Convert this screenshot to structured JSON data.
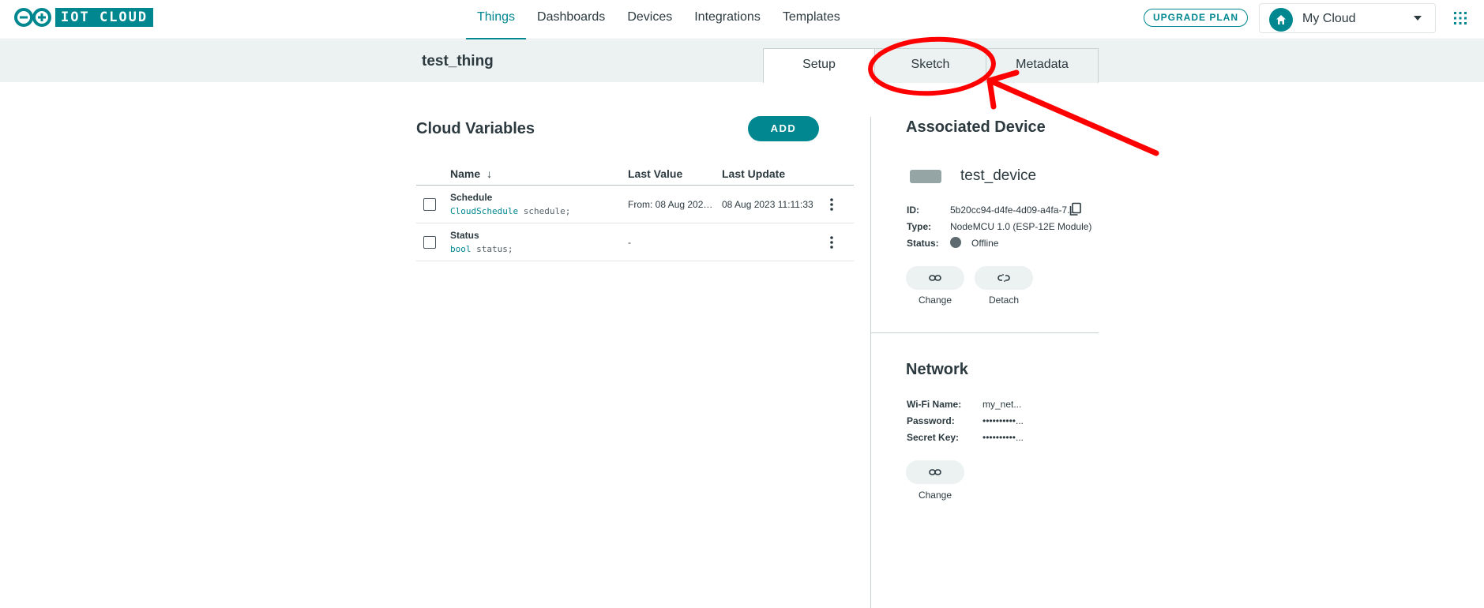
{
  "header": {
    "logo_text": "IOT CLOUD",
    "nav": [
      "Things",
      "Dashboards",
      "Devices",
      "Integrations",
      "Templates"
    ],
    "active_nav": "Things",
    "upgrade_label": "UPGRADE PLAN",
    "space_name": "My Cloud",
    "icons": {
      "space": "home-icon",
      "caret": "caret-down-icon",
      "apps": "apps-grid-icon"
    }
  },
  "thing": {
    "title": "test_thing",
    "tabs": [
      "Setup",
      "Sketch",
      "Metadata"
    ],
    "active_tab": "Setup"
  },
  "variables": {
    "title": "Cloud Variables",
    "add_label": "ADD",
    "columns": {
      "name": "Name",
      "last_value": "Last Value",
      "last_update": "Last Update"
    },
    "sort_icon": "arrow-down-icon",
    "rows": [
      {
        "name": "Schedule",
        "type": "CloudSchedule",
        "var": " schedule;",
        "last_value": "From: 08 Aug 2023 ...",
        "last_update": "08 Aug 2023 11:11:33"
      },
      {
        "name": "Status",
        "type": "bool",
        "var": " status;",
        "last_value": "-",
        "last_update": ""
      }
    ]
  },
  "device": {
    "title": "Associated Device",
    "name": "test_device",
    "id_label": "ID:",
    "id_value": "5b20cc94-d4fe-4d09-a4fa-7...",
    "type_label": "Type:",
    "type_value": "NodeMCU 1.0 (ESP-12E Module)",
    "status_label": "Status:",
    "status_value": "Offline",
    "status_color": "#5d6a70",
    "change_label": "Change",
    "detach_label": "Detach"
  },
  "network": {
    "title": "Network",
    "wifi_label": "Wi-Fi Name:",
    "wifi_value": "my_net...",
    "password_label": "Password:",
    "password_value": "••••••••••...",
    "secret_label": "Secret Key:",
    "secret_value": "••••••••••...",
    "change_label": "Change"
  },
  "colors": {
    "accent": "#00878f",
    "annotation": "#ff0000",
    "strip": "#ecf1f1"
  }
}
